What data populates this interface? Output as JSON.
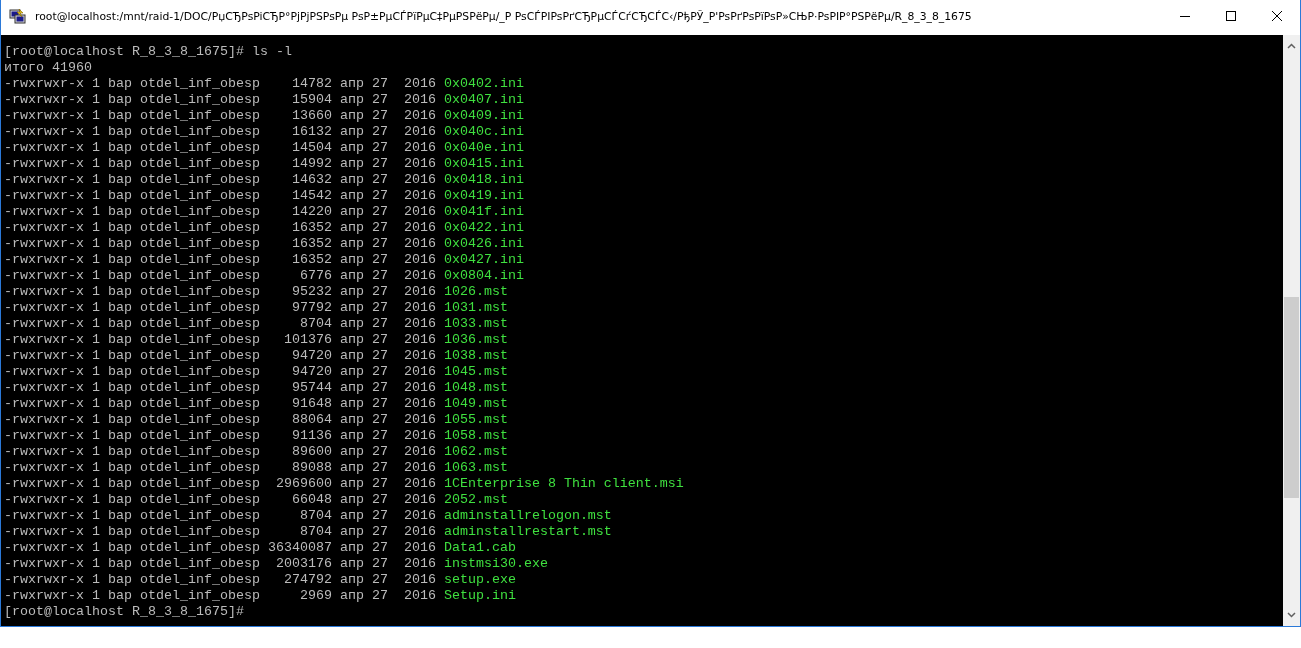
{
  "window": {
    "title": "root@localhost:/mnt/raid-1/DOC/PџCЂPsPiCЂP°PjPjPSPsPµ PsP±PµCЃPïPµC‡PµPSPёPµ/_P PsCЃPIPsPґCЂPµCЃCѓCЂCЃC‹/PђPЎ_P'PsPґPsPïPsP»CЊP·PsPIP°PSPёPµ/R_8_3_8_1675"
  },
  "terminal": {
    "lines": [
      {
        "kind": "prompt",
        "text": "[root@localhost R_8_3_8_1675]# ls -l"
      },
      {
        "kind": "text",
        "text": "итого 41960"
      },
      {
        "kind": "entry",
        "info": "-rwxrwxr-x 1 bap otdel_inf_obesp    14782 апр 27  2016",
        "name": "0x0402.ini"
      },
      {
        "kind": "entry",
        "info": "-rwxrwxr-x 1 bap otdel_inf_obesp    15904 апр 27  2016",
        "name": "0x0407.ini"
      },
      {
        "kind": "entry",
        "info": "-rwxrwxr-x 1 bap otdel_inf_obesp    13660 апр 27  2016",
        "name": "0x0409.ini"
      },
      {
        "kind": "entry",
        "info": "-rwxrwxr-x 1 bap otdel_inf_obesp    16132 апр 27  2016",
        "name": "0x040c.ini"
      },
      {
        "kind": "entry",
        "info": "-rwxrwxr-x 1 bap otdel_inf_obesp    14504 апр 27  2016",
        "name": "0x040e.ini"
      },
      {
        "kind": "entry",
        "info": "-rwxrwxr-x 1 bap otdel_inf_obesp    14992 апр 27  2016",
        "name": "0x0415.ini"
      },
      {
        "kind": "entry",
        "info": "-rwxrwxr-x 1 bap otdel_inf_obesp    14632 апр 27  2016",
        "name": "0x0418.ini"
      },
      {
        "kind": "entry",
        "info": "-rwxrwxr-x 1 bap otdel_inf_obesp    14542 апр 27  2016",
        "name": "0x0419.ini"
      },
      {
        "kind": "entry",
        "info": "-rwxrwxr-x 1 bap otdel_inf_obesp    14220 апр 27  2016",
        "name": "0x041f.ini"
      },
      {
        "kind": "entry",
        "info": "-rwxrwxr-x 1 bap otdel_inf_obesp    16352 апр 27  2016",
        "name": "0x0422.ini"
      },
      {
        "kind": "entry",
        "info": "-rwxrwxr-x 1 bap otdel_inf_obesp    16352 апр 27  2016",
        "name": "0x0426.ini"
      },
      {
        "kind": "entry",
        "info": "-rwxrwxr-x 1 bap otdel_inf_obesp    16352 апр 27  2016",
        "name": "0x0427.ini"
      },
      {
        "kind": "entry",
        "info": "-rwxrwxr-x 1 bap otdel_inf_obesp     6776 апр 27  2016",
        "name": "0x0804.ini"
      },
      {
        "kind": "entry",
        "info": "-rwxrwxr-x 1 bap otdel_inf_obesp    95232 апр 27  2016",
        "name": "1026.mst"
      },
      {
        "kind": "entry",
        "info": "-rwxrwxr-x 1 bap otdel_inf_obesp    97792 апр 27  2016",
        "name": "1031.mst"
      },
      {
        "kind": "entry",
        "info": "-rwxrwxr-x 1 bap otdel_inf_obesp     8704 апр 27  2016",
        "name": "1033.mst"
      },
      {
        "kind": "entry",
        "info": "-rwxrwxr-x 1 bap otdel_inf_obesp   101376 апр 27  2016",
        "name": "1036.mst"
      },
      {
        "kind": "entry",
        "info": "-rwxrwxr-x 1 bap otdel_inf_obesp    94720 апр 27  2016",
        "name": "1038.mst"
      },
      {
        "kind": "entry",
        "info": "-rwxrwxr-x 1 bap otdel_inf_obesp    94720 апр 27  2016",
        "name": "1045.mst"
      },
      {
        "kind": "entry",
        "info": "-rwxrwxr-x 1 bap otdel_inf_obesp    95744 апр 27  2016",
        "name": "1048.mst"
      },
      {
        "kind": "entry",
        "info": "-rwxrwxr-x 1 bap otdel_inf_obesp    91648 апр 27  2016",
        "name": "1049.mst"
      },
      {
        "kind": "entry",
        "info": "-rwxrwxr-x 1 bap otdel_inf_obesp    88064 апр 27  2016",
        "name": "1055.mst"
      },
      {
        "kind": "entry",
        "info": "-rwxrwxr-x 1 bap otdel_inf_obesp    91136 апр 27  2016",
        "name": "1058.mst"
      },
      {
        "kind": "entry",
        "info": "-rwxrwxr-x 1 bap otdel_inf_obesp    89600 апр 27  2016",
        "name": "1062.mst"
      },
      {
        "kind": "entry",
        "info": "-rwxrwxr-x 1 bap otdel_inf_obesp    89088 апр 27  2016",
        "name": "1063.mst"
      },
      {
        "kind": "entry",
        "info": "-rwxrwxr-x 1 bap otdel_inf_obesp  2969600 апр 27  2016",
        "name": "1CEnterprise 8 Thin client.msi"
      },
      {
        "kind": "entry",
        "info": "-rwxrwxr-x 1 bap otdel_inf_obesp    66048 апр 27  2016",
        "name": "2052.mst"
      },
      {
        "kind": "entry",
        "info": "-rwxrwxr-x 1 bap otdel_inf_obesp     8704 апр 27  2016",
        "name": "adminstallrelogon.mst"
      },
      {
        "kind": "entry",
        "info": "-rwxrwxr-x 1 bap otdel_inf_obesp     8704 апр 27  2016",
        "name": "adminstallrestart.mst"
      },
      {
        "kind": "entry",
        "info": "-rwxrwxr-x 1 bap otdel_inf_obesp 36340087 апр 27  2016",
        "name": "Data1.cab"
      },
      {
        "kind": "entry",
        "info": "-rwxrwxr-x 1 bap otdel_inf_obesp  2003176 апр 27  2016",
        "name": "instmsi30.exe"
      },
      {
        "kind": "entry",
        "info": "-rwxrwxr-x 1 bap otdel_inf_obesp   274792 апр 27  2016",
        "name": "setup.exe"
      },
      {
        "kind": "entry",
        "info": "-rwxrwxr-x 1 bap otdel_inf_obesp     2969 апр 27  2016",
        "name": "Setup.ini"
      },
      {
        "kind": "prompt",
        "text": "[root@localhost R_8_3_8_1675]#"
      }
    ]
  }
}
